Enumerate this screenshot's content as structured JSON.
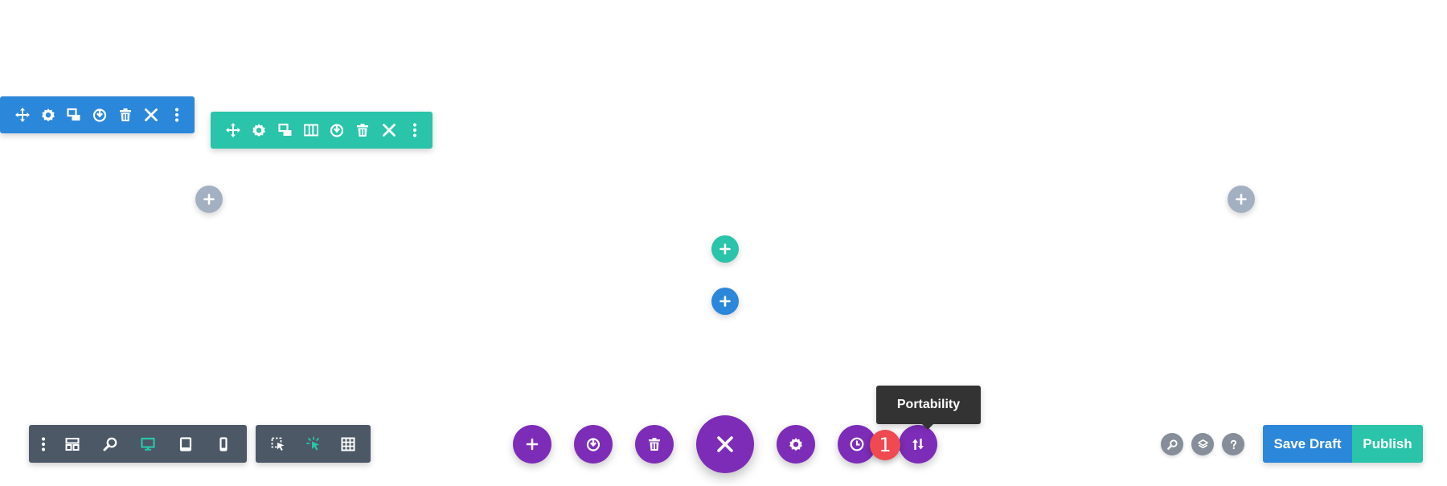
{
  "section_toolbar": {
    "color": "#2b87da",
    "icons": [
      "move-icon",
      "gear-icon",
      "duplicate-icon",
      "save-to-library-icon",
      "trash-icon",
      "close-icon",
      "more-vertical-icon"
    ]
  },
  "row_toolbar": {
    "color": "#29c4a9",
    "icons": [
      "move-icon",
      "gear-icon",
      "duplicate-icon",
      "columns-icon",
      "save-to-library-icon",
      "trash-icon",
      "close-icon",
      "more-vertical-icon"
    ]
  },
  "add_buttons": {
    "add_module_left_color": "#a2b0c1",
    "add_module_right_color": "#a2b0c1",
    "add_row_color": "#29c4a9",
    "add_section_color": "#2b87da"
  },
  "settings_bar": {
    "main_icons": [
      "more-vertical-icon",
      "wireframe-icon",
      "zoom-icon",
      "desktop-icon",
      "tablet-icon",
      "phone-icon"
    ],
    "active_view": "desktop",
    "mode_icons": [
      "click-mode-icon",
      "hover-mode-icon",
      "grid-mode-icon"
    ]
  },
  "page_settings": {
    "color": "#7d2cb8",
    "icons": [
      "add-icon",
      "load-layout-icon",
      "clear-layout-icon",
      "close-icon",
      "page-settings-icon",
      "history-icon",
      "portability-icon"
    ]
  },
  "tooltip": {
    "text": "Portability"
  },
  "badge": {
    "text": "1",
    "color": "#ef4a4f"
  },
  "utility_icons": [
    "search-icon",
    "layers-icon",
    "help-icon"
  ],
  "actions": {
    "save_draft": "Save Draft",
    "publish": "Publish"
  }
}
